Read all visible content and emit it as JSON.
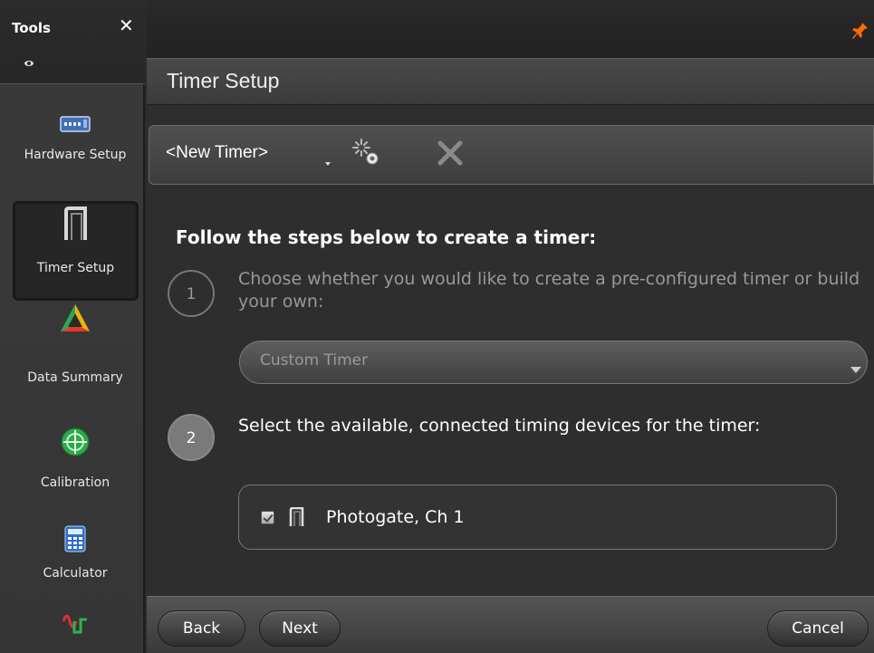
{
  "sidebar": {
    "title": "Tools",
    "close_symbol": "✕",
    "items": [
      {
        "label": "Hardware Setup",
        "icon": "hardware-icon"
      },
      {
        "label": "Timer Setup",
        "icon": "photogate-icon",
        "active": true
      },
      {
        "label": "Data Summary",
        "icon": "data-summary-icon"
      },
      {
        "label": "Calibration",
        "icon": "calibration-icon"
      },
      {
        "label": "Calculator",
        "icon": "calculator-icon"
      },
      {
        "label": "",
        "icon": "signal-generator-icon"
      }
    ]
  },
  "header": {
    "title": "Timer Setup"
  },
  "timer_bar": {
    "current_timer": "<New Timer>"
  },
  "instructions": {
    "heading": "Follow the steps below to create a timer:",
    "step1": {
      "number": "1",
      "text": "Choose whether you would like to create a pre-configured timer or build your own:",
      "dropdown_value": "Custom Timer"
    },
    "step2": {
      "number": "2",
      "text": "Select the available, connected timing devices for the timer:",
      "devices": [
        {
          "label": "Photogate, Ch 1",
          "checked": true
        }
      ]
    }
  },
  "footer": {
    "back_label": "Back",
    "next_label": "Next",
    "cancel_label": "Cancel"
  },
  "colors": {
    "accent_pin": "#ff6a00",
    "delete_x": "#8a8a8a"
  }
}
